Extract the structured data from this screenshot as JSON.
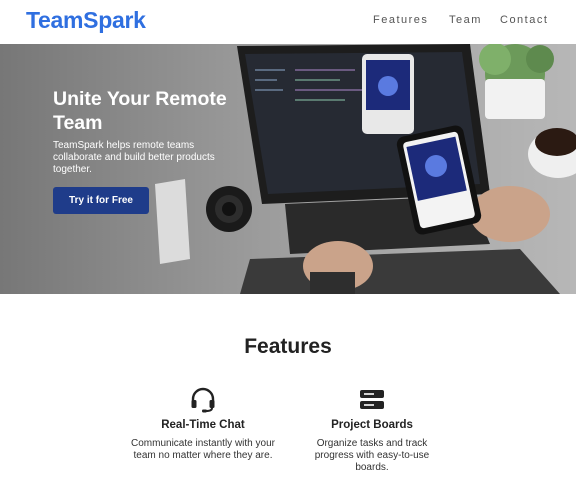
{
  "header": {
    "logo": "TeamSpark",
    "nav": [
      "Features",
      "Team",
      "Contact"
    ]
  },
  "hero": {
    "title": "Unite Your Remote Team",
    "subtitle": "TeamSpark helps remote teams collaborate and build better products together.",
    "cta_label": "Try it for Free",
    "image_alt": "laptop-and-phone-photo"
  },
  "features": {
    "title": "Features",
    "items": [
      {
        "icon": "headset-icon",
        "name": "Real-Time Chat",
        "description": "Communicate instantly with your team no matter where they are."
      },
      {
        "icon": "server-icon",
        "name": "Project Boards",
        "description": "Organize tasks and track progress with easy-to-use boards."
      }
    ]
  },
  "colors": {
    "brand": "#2f6fe0",
    "cta": "#1f3c8a"
  }
}
